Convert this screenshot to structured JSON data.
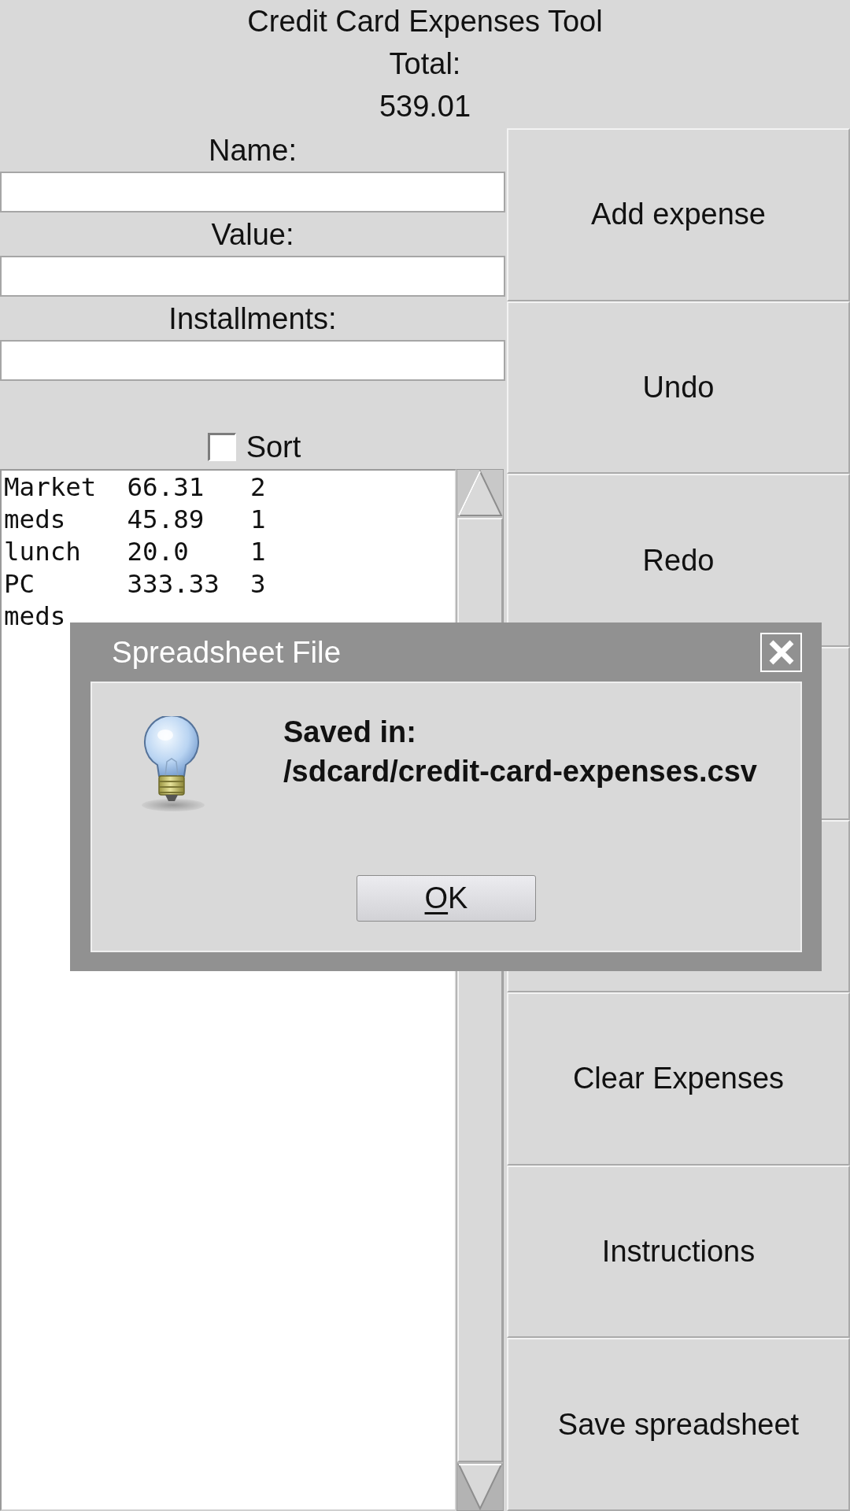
{
  "window": {
    "title": "Credit Card Expenses Tool"
  },
  "total": {
    "label": "Total:",
    "value": "539.01"
  },
  "form": {
    "fields": [
      {
        "label": "Name:"
      },
      {
        "label": "Value:"
      },
      {
        "label": "Installments:"
      }
    ],
    "sort": {
      "label": "Sort",
      "checked": false
    }
  },
  "expenses": {
    "rows": [
      "Market  66.31   2",
      "meds    45.89   1",
      "lunch   20.0    1",
      "PC      333.33  3",
      "meds"
    ]
  },
  "buttons": [
    {
      "kind": "labeled",
      "label": "Add expense"
    },
    {
      "kind": "labeled",
      "label": "Undo"
    },
    {
      "kind": "labeled",
      "label": "Redo"
    },
    {
      "kind": "covered"
    },
    {
      "kind": "covered"
    },
    {
      "kind": "labeled",
      "label": "Clear Expenses"
    },
    {
      "kind": "labeled",
      "label": "Instructions"
    },
    {
      "kind": "labeled",
      "label": "Save spreadsheet"
    }
  ],
  "dialog": {
    "title": "Spreadsheet File",
    "message": "Saved in:\n/sdcard/credit-card-expenses.csv",
    "button": {
      "label": "OK",
      "mnemonic_underline": true
    }
  }
}
